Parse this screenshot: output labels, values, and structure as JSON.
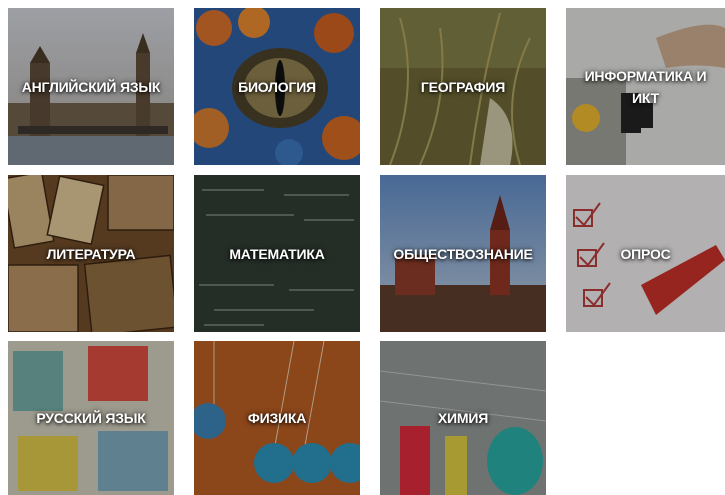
{
  "subjects": [
    {
      "label": "АНГЛИЙСКИЙ ЯЗЫК",
      "icon": "london-icon"
    },
    {
      "label": "БИОЛОГИЯ",
      "icon": "reptile-eye-icon"
    },
    {
      "label": "ГЕОГРАФИЯ",
      "icon": "plant-icon"
    },
    {
      "label": "ИНФОРМАТИКА И ИКТ",
      "icon": "robot-hand-icon"
    },
    {
      "label": "ЛИТЕРАТУРА",
      "icon": "books-icon"
    },
    {
      "label": "МАТЕМАТИКА",
      "icon": "chalkboard-icon"
    },
    {
      "label": "ОБЩЕСТВОЗНАНИЕ",
      "icon": "kremlin-icon"
    },
    {
      "label": "ОПРОС",
      "icon": "checklist-icon"
    },
    {
      "label": "РУССКИЙ ЯЗЫК",
      "icon": "letters-icon"
    },
    {
      "label": "ФИЗИКА",
      "icon": "pendulum-icon"
    },
    {
      "label": "ХИМИЯ",
      "icon": "flasks-icon"
    }
  ]
}
